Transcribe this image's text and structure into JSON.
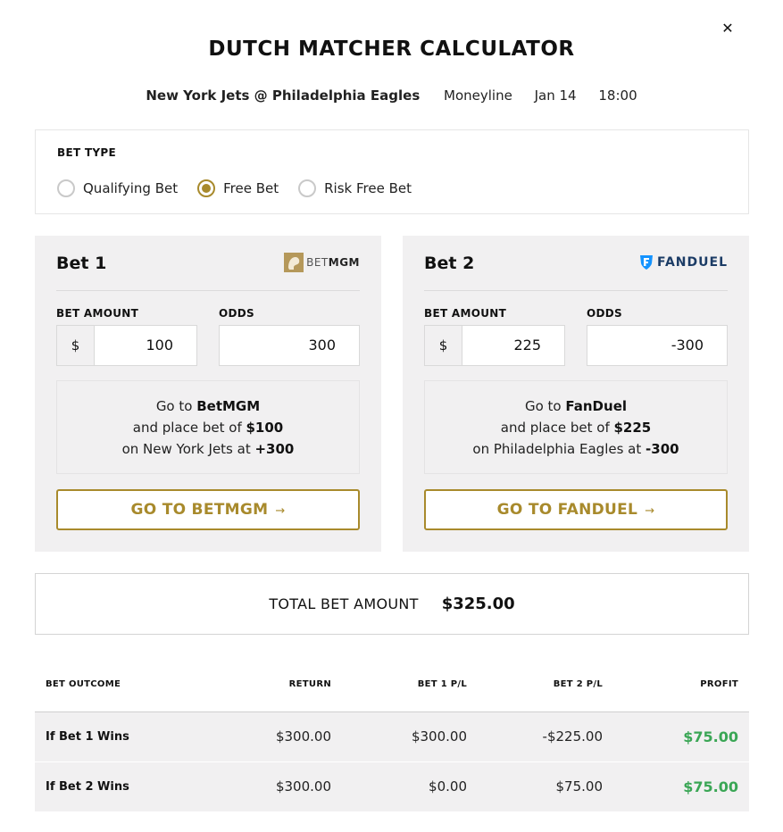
{
  "title": "DUTCH MATCHER CALCULATOR",
  "event": {
    "teams": "New York Jets @ Philadelphia Eagles",
    "market": "Moneyline",
    "date": "Jan 14",
    "time": "18:00"
  },
  "bet_type": {
    "label": "BET TYPE",
    "options": [
      "Qualifying Bet",
      "Free Bet",
      "Risk Free Bet"
    ],
    "selected": "Free Bet"
  },
  "bet1": {
    "title": "Bet 1",
    "bookmaker_logo_text": "BETMGM",
    "amount_label": "BET AMOUNT",
    "odds_label": "ODDS",
    "currency": "$",
    "amount": "100",
    "odds": "300",
    "instr_line1_pre": "Go to ",
    "instr_book": "BetMGM",
    "instr_line2_pre": "and place bet of ",
    "instr_amount": "$100",
    "instr_line3_pre": "on New York Jets at ",
    "instr_odds": "+300",
    "button": "GO TO BETMGM",
    "accent": "#a88a2c"
  },
  "bet2": {
    "title": "Bet 2",
    "bookmaker_logo_text": "FANDUEL",
    "amount_label": "BET AMOUNT",
    "odds_label": "ODDS",
    "currency": "$",
    "amount": "225",
    "odds": "-300",
    "instr_line1_pre": "Go to ",
    "instr_book": "FanDuel",
    "instr_line2_pre": "and place bet of ",
    "instr_amount": "$225",
    "instr_line3_pre": "on Philadelphia Eagles at ",
    "instr_odds": "-300",
    "button": "GO TO FANDUEL",
    "accent": "#1493ff"
  },
  "total": {
    "label": "TOTAL BET AMOUNT",
    "value": "$325.00"
  },
  "outcomes": {
    "headers": [
      "BET OUTCOME",
      "RETURN",
      "BET 1 P/L",
      "BET 2 P/L",
      "PROFIT"
    ],
    "rows": [
      {
        "outcome": "If Bet 1 Wins",
        "return": "$300.00",
        "bet1_pl": "$300.00",
        "bet2_pl": "-$225.00",
        "profit": "$75.00"
      },
      {
        "outcome": "If Bet 2 Wins",
        "return": "$300.00",
        "bet1_pl": "$0.00",
        "bet2_pl": "$75.00",
        "profit": "$75.00"
      }
    ],
    "profit_color": "#3aa655"
  }
}
